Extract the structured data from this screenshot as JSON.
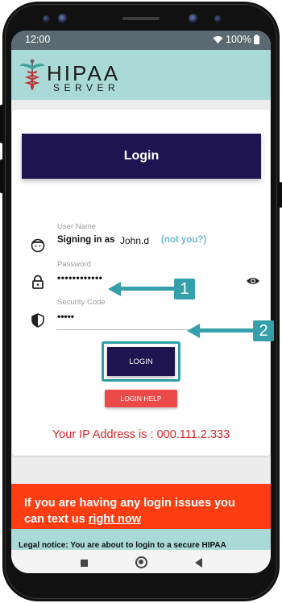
{
  "status_bar": {
    "time": "12:00",
    "battery": "100%"
  },
  "header": {
    "logo_main": "HIPAA",
    "logo_sub": "SERVER"
  },
  "login_panel": {
    "title": "Login",
    "username_label": "User Name",
    "signing_in_as": "Signing in as",
    "username_value": "John.d",
    "not_you": "(not you?)",
    "password_label": "Password",
    "password_value": "••••••••••••",
    "security_code_label": "Security Code",
    "security_code_value": "•••••",
    "login_button": "LOGIN",
    "login_help_button": "LOGIN HELP",
    "ip_text": "Your IP Address is : 000.111.2.333"
  },
  "notice": {
    "text_prefix": "If you are having any login issues you can text us ",
    "link": "right now"
  },
  "legal": {
    "text": "Legal notice: You are about to login to a secure HIPAA"
  },
  "annotations": {
    "badge_1": "1",
    "badge_2": "2"
  },
  "colors": {
    "header_bg": "#a9dad7",
    "primary": "#1d1450",
    "danger": "#ec4a48",
    "notice_bg": "#ff3d12",
    "annotation": "#35a0aa"
  },
  "icons": [
    "wifi-icon",
    "battery-icon",
    "caduceus-icon",
    "face-icon",
    "lock-icon",
    "shield-icon",
    "eye-icon"
  ]
}
